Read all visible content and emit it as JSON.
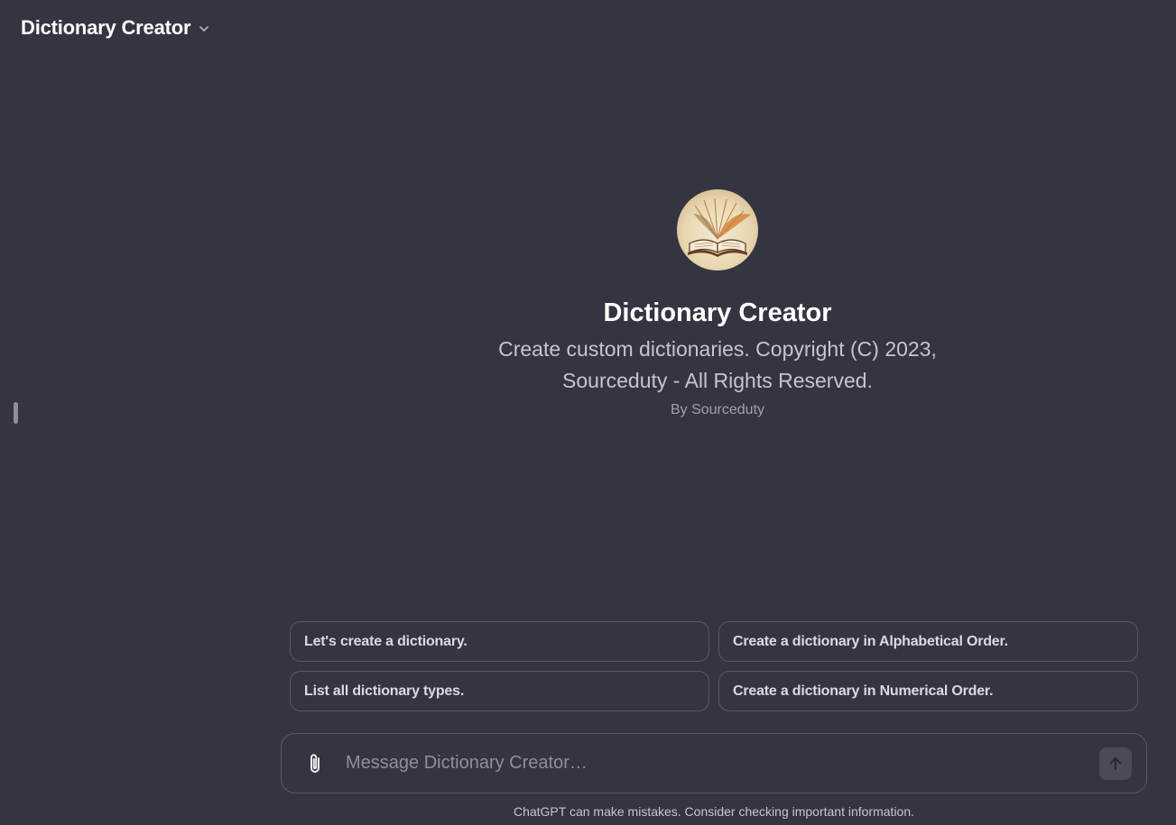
{
  "header": {
    "title": "Dictionary Creator"
  },
  "gpt": {
    "name": "Dictionary Creator",
    "description": "Create custom dictionaries. Copyright (C) 2023, Sourceduty - All Rights Reserved.",
    "author": "By Sourceduty"
  },
  "starters": [
    {
      "label": "Let's create a dictionary."
    },
    {
      "label": "Create a dictionary in Alphabetical Order."
    },
    {
      "label": "List all dictionary types."
    },
    {
      "label": "Create a dictionary in Numerical Order."
    }
  ],
  "composer": {
    "placeholder": "Message Dictionary Creator…"
  },
  "footer": {
    "note": "ChatGPT can make mistakes. Consider checking important information."
  },
  "icons": {
    "header_chevron": "chevron-down-icon",
    "attach": "paperclip-icon",
    "send": "arrow-up-icon",
    "avatar": "open-book-icon"
  }
}
